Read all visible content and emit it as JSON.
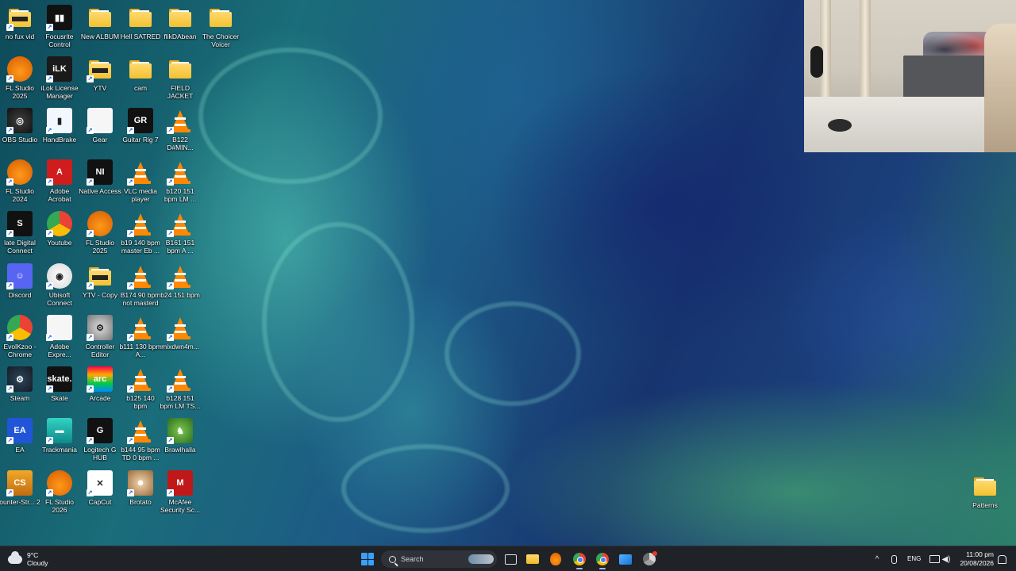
{
  "desktop": {
    "columns": [
      [
        {
          "label": "no fux vid",
          "icon": "video-folder-icon"
        },
        {
          "label": "FL Studio 2025",
          "icon": "fl-studio-icon"
        },
        {
          "label": "OBS Studio",
          "icon": "obs-icon"
        },
        {
          "label": "FL Studio 2024",
          "icon": "fl-studio-icon"
        },
        {
          "label": "late Digital Connect",
          "icon": "slate-digital-icon"
        },
        {
          "label": "Discord",
          "icon": "discord-icon"
        },
        {
          "label": "EvolKzoo - Chrome",
          "icon": "chrome-icon"
        },
        {
          "label": "Steam",
          "icon": "steam-icon"
        },
        {
          "label": "EA",
          "icon": "ea-icon"
        },
        {
          "label": "ounter-Str... 2",
          "icon": "counter-strike-icon"
        }
      ],
      [
        {
          "label": "Focusrite Control",
          "icon": "focusrite-icon"
        },
        {
          "label": "iLok License Manager",
          "icon": "ilok-icon"
        },
        {
          "label": "HandBrake",
          "icon": "handbrake-icon"
        },
        {
          "label": "Adobe Acrobat",
          "icon": "acrobat-icon"
        },
        {
          "label": "Youtube",
          "icon": "chrome-icon"
        },
        {
          "label": "Ubisoft Connect",
          "icon": "ubisoft-icon"
        },
        {
          "label": "Adobe Expre...",
          "icon": "document-icon"
        },
        {
          "label": "Skate",
          "icon": "skate-icon"
        },
        {
          "label": "Trackmania",
          "icon": "trackmania-icon"
        },
        {
          "label": "FL Studio 2026",
          "icon": "fl-studio-icon"
        }
      ],
      [
        {
          "label": "New ALBUM",
          "icon": "folder-icon"
        },
        {
          "label": "YTV",
          "icon": "video-folder-icon"
        },
        {
          "label": "Gear",
          "icon": "document-icon"
        },
        {
          "label": "Native Access",
          "icon": "native-access-icon"
        },
        {
          "label": "FL Studio 2025",
          "icon": "fl-studio-icon"
        },
        {
          "label": "YTV - Copy",
          "icon": "video-folder-icon"
        },
        {
          "label": "Controller Editor",
          "icon": "controller-editor-icon"
        },
        {
          "label": "Arcade",
          "icon": "arcade-icon"
        },
        {
          "label": "Logitech G HUB",
          "icon": "logitech-icon"
        },
        {
          "label": "CapCut",
          "icon": "capcut-icon"
        }
      ],
      [
        {
          "label": "Hell SATRED",
          "icon": "folder-icon"
        },
        {
          "label": "cam",
          "icon": "folder-icon"
        },
        {
          "label": "Guitar Rig 7",
          "icon": "guitar-rig-icon"
        },
        {
          "label": "VLC media player",
          "icon": "vlc-icon"
        },
        {
          "label": "b19 140 bpm master Eb ...",
          "icon": "vlc-icon"
        },
        {
          "label": "B174 90 bpm not masterd",
          "icon": "vlc-icon"
        },
        {
          "label": "b111 130 bpm A...",
          "icon": "vlc-icon"
        },
        {
          "label": "b125 140 bpm",
          "icon": "vlc-icon"
        },
        {
          "label": "b144 95 bpm TD 0 bpm ...",
          "icon": "vlc-icon"
        },
        {
          "label": "Brotato",
          "icon": "brotato-icon"
        }
      ],
      [
        {
          "label": "flikDAbean",
          "icon": "folder-icon"
        },
        {
          "label": "FIELD JACKET FILES",
          "icon": "folder-icon"
        },
        {
          "label": "B122 D#MIN...",
          "icon": "vlc-icon"
        },
        {
          "label": "b120 151 bpm LM ...",
          "icon": "vlc-icon"
        },
        {
          "label": "B161 151 bpm A ...",
          "icon": "vlc-icon"
        },
        {
          "label": "b24 151 bpm",
          "icon": "vlc-icon"
        },
        {
          "label": "mixdwn4m...",
          "icon": "vlc-icon"
        },
        {
          "label": "b128 151 bpm LM TS...",
          "icon": "vlc-icon"
        },
        {
          "label": "Brawlhalla",
          "icon": "brawlhalla-icon"
        },
        {
          "label": "McAfee Security Sc...",
          "icon": "mcafee-icon"
        }
      ],
      [
        {
          "label": "The Choicer Voicer",
          "icon": "folder-icon"
        }
      ]
    ],
    "patterns": {
      "label": "Patterns",
      "icon": "folder-icon"
    }
  },
  "taskbar": {
    "weather": {
      "temp": "9°C",
      "condition": "Cloudy"
    },
    "search_placeholder": "Search",
    "language": "ENG",
    "time": "11:00 pm",
    "date": "20/08/2026",
    "apps": [
      "task-view",
      "file-explorer",
      "fl-studio",
      "chrome",
      "chrome",
      "photos",
      "chrome-canary"
    ]
  },
  "colors": {
    "taskbar_bg": "#1f2226",
    "folder": "#f4c12f",
    "vlc": "#ff8800",
    "accent": "#3aa0ff"
  }
}
